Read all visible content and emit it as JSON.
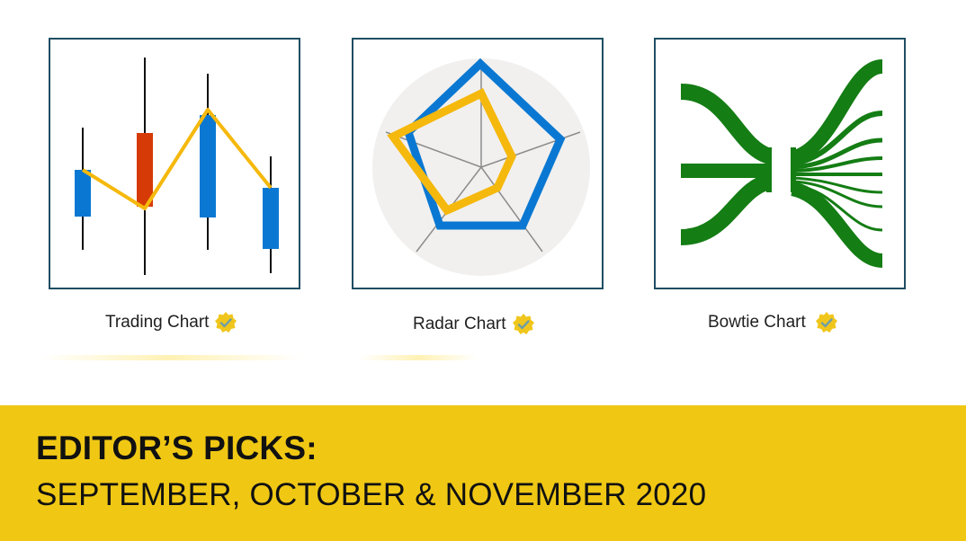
{
  "cards": [
    {
      "label": "Trading Chart"
    },
    {
      "label": "Radar Chart"
    },
    {
      "label": "Bowtie Chart"
    }
  ],
  "banner": {
    "headline": "EDITOR’S PICKS:",
    "subline": "SEPTEMBER, OCTOBER & NOVEMBER 2020",
    "color": "#f0c814"
  },
  "icons": {
    "badge": "verified-badge-icon"
  },
  "colors": {
    "frame": "#1f4e63",
    "blue": "#0a78d2",
    "red": "#d63a07",
    "gold": "#f5b80c",
    "green": "#147d14",
    "radar_bg": "#f1f0ef"
  }
}
